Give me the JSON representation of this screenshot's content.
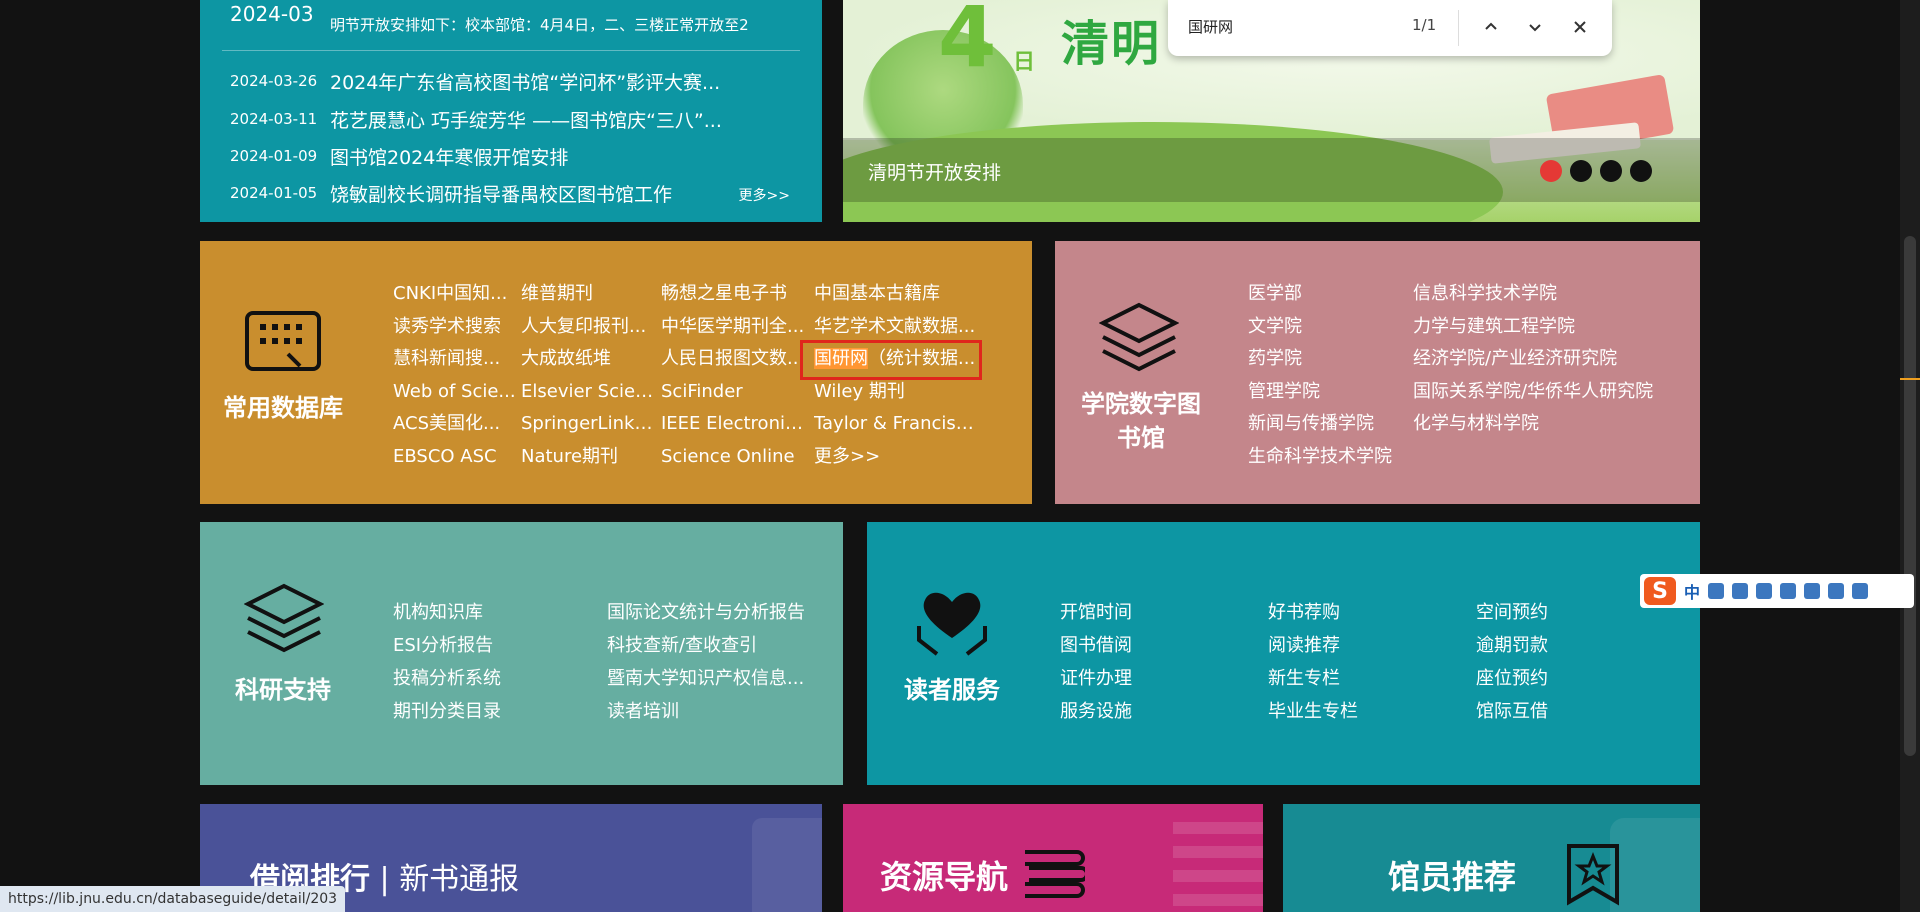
{
  "news": {
    "top_date": "2024-03",
    "top_text": "明节开放安排如下：校本部馆：4月4日，二、三楼正常开放至2",
    "items": [
      {
        "date": "2024-03-26",
        "title": "2024年广东省高校图书馆“学问杯”影评大赛..."
      },
      {
        "date": "2024-03-11",
        "title": "花艺展慧心 巧手绽芳华 ——图书馆庆“三八”..."
      },
      {
        "date": "2024-01-09",
        "title": "图书馆2024年寒假开馆安排"
      },
      {
        "date": "2024-01-05",
        "title": "饶敏副校长调研指导番禺校区图书馆工作"
      }
    ],
    "more": "更多>>"
  },
  "banner": {
    "big_number": "4",
    "day_char": "日",
    "headline": "清明",
    "caption": "清明节开放安排",
    "slides": 4,
    "active_slide": 1
  },
  "findbar": {
    "query": "国研网",
    "count": "1/1",
    "icons": [
      "chevron-up-icon",
      "chevron-down-icon",
      "close-icon"
    ]
  },
  "databases": {
    "title": "常用数据库",
    "links": [
      "CNKI中国知...",
      "维普期刊",
      "畅想之星电子书",
      "中国基本古籍库",
      "读秀学术搜索",
      "人大复印报刊...",
      "中华医学期刊全...",
      "华艺学术文献数据...",
      "慧科新闻搜...",
      "大成故纸堆",
      "人民日报图文数...",
      "国研网（统计数据...",
      "Web of Scie...",
      "Elsevier Scien...",
      "SciFinder",
      "Wiley 期刊",
      "ACS美国化...",
      "SpringerLink ...",
      "IEEE Electronic ...",
      "Taylor & Francis期刊",
      "EBSCO ASC",
      "Nature期刊",
      "Science Online",
      "更多>>"
    ],
    "highlight_match": "国研网",
    "highlight_rest": "（统计数据..."
  },
  "college": {
    "title": "学院数字图书馆",
    "col1": [
      "医学部",
      "文学院",
      "药学院",
      "管理学院",
      "新闻与传播学院",
      "生命科学技术学院"
    ],
    "col2": [
      "信息科学技术学院",
      "力学与建筑工程学院",
      "经济学院/产业经济研究院",
      "国际关系学院/华侨华人研究院",
      "化学与材料学院"
    ]
  },
  "research": {
    "title": "科研支持",
    "links": [
      "机构知识库",
      "国际论文统计与分析报告",
      "ESI分析报告",
      "科技查新/查收查引",
      "投稿分析系统",
      "暨南大学知识产权信息...",
      "期刊分类目录",
      "读者培训"
    ]
  },
  "reader": {
    "title": "读者服务",
    "links": [
      "开馆时间",
      "好书荐购",
      "空间预约",
      "图书借阅",
      "阅读推荐",
      "逾期罚款",
      "证件办理",
      "新生专栏",
      "座位预约",
      "服务设施",
      "毕业生专栏",
      "馆际互借"
    ]
  },
  "bottom": {
    "rank_bold": "借阅排行",
    "rank_sep": " | ",
    "rank_rest": "新书通报",
    "nav_title": "资源导航",
    "staff_title": "馆员推荐"
  },
  "ime": {
    "logo": "S",
    "lang": "中"
  },
  "status_url": "https://lib.jnu.edu.cn/databaseguide/detail/203",
  "colors": {
    "news_bg": "#0d96a3",
    "db_bg": "#c98e2e",
    "college_bg": "#c4868b",
    "research_bg": "#66aea1",
    "reader_bg": "#0d96a3",
    "highlight_border": "#e0261c",
    "find_match": "#ff9632"
  }
}
